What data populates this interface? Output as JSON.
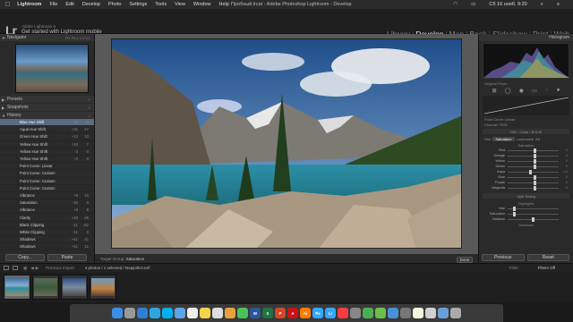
{
  "menubar": {
    "apple": "",
    "app": "Lightroom",
    "items": [
      "File",
      "Edit",
      "Develop",
      "Photo",
      "Settings",
      "Tools",
      "View",
      "Window",
      "Help"
    ],
    "window_title": "Пробный.lrcat - Adobe Photoshop Lightroom - Develop",
    "clock": "Сб 16 нояб. 9:20"
  },
  "identity": {
    "logo": "Lr",
    "product": "Adobe Lightroom 6",
    "tagline": "Get started with Lightroom mobile"
  },
  "modules": [
    {
      "label": "Library",
      "active": false
    },
    {
      "label": "Develop",
      "active": true
    },
    {
      "label": "Map",
      "active": false
    },
    {
      "label": "Book",
      "active": false
    },
    {
      "label": "Slideshow",
      "active": false
    },
    {
      "label": "Print",
      "active": false
    },
    {
      "label": "Web",
      "active": false
    }
  ],
  "left": {
    "navigator": {
      "title": "Navigator",
      "zoom": "FIT FILL 1:1 3:1"
    },
    "presets": "Presets",
    "snapshots": "Snapshots",
    "history_title": "History",
    "history": [
      {
        "label": "Blue Hue Shift",
        "b": "-33",
        "c": "0",
        "selected": true
      },
      {
        "label": "Aqua Hue Shift",
        "b": "+31",
        "c": "47",
        "selected": false
      },
      {
        "label": "Green Hue Shift",
        "b": "+13",
        "c": "13",
        "selected": false
      },
      {
        "label": "Yellow Hue Shift",
        "b": "+10",
        "c": "7",
        "selected": false
      },
      {
        "label": "Yellow Hue Shift",
        "b": "-3",
        "c": "-3",
        "selected": false
      },
      {
        "label": "Yellow Hue Shift",
        "b": "+2",
        "c": "0",
        "selected": false
      },
      {
        "label": "Point Curve: Linear",
        "b": "",
        "c": "",
        "selected": false
      },
      {
        "label": "Point Curve: Custom",
        "b": "",
        "c": "",
        "selected": false
      },
      {
        "label": "Point Curve: Custom",
        "b": "",
        "c": "",
        "selected": false
      },
      {
        "label": "Point Curve: Custom",
        "b": "",
        "c": "",
        "selected": false
      },
      {
        "label": "Vibrance",
        "b": "+8",
        "c": "16",
        "selected": false
      },
      {
        "label": "Saturation",
        "b": "-16",
        "c": "0",
        "selected": false
      },
      {
        "label": "Vibrance",
        "b": "+8",
        "c": "8",
        "selected": false
      },
      {
        "label": "Clarity",
        "b": "+19",
        "c": "26",
        "selected": false
      },
      {
        "label": "Black Clipping",
        "b": "-11",
        "c": "-52",
        "selected": false
      },
      {
        "label": "White Clipping",
        "b": "-11",
        "c": "0",
        "selected": false
      },
      {
        "label": "Shadows",
        "b": "+41",
        "c": "41",
        "selected": false
      },
      {
        "label": "Shadows",
        "b": "+11",
        "c": "11",
        "selected": false
      }
    ],
    "copy_label": "Copy...",
    "paste_label": "Paste"
  },
  "toolbar": {
    "target_label": "Target Group:",
    "target_value": "Saturation",
    "done_label": "Done"
  },
  "right": {
    "histogram_title": "Histogram",
    "original_photo": "Original Photo",
    "point_curve": "Point Curve: Linear",
    "channel": "Channel: RGB",
    "hsl_tabs": [
      "HSL",
      "Color",
      "B & W"
    ],
    "sub_tabs": [
      "Hue",
      "Saturation",
      "Luminance",
      "All"
    ],
    "sliders_title": "Saturation",
    "sliders": [
      {
        "label": "Red",
        "value": "0",
        "pos": 0.5
      },
      {
        "label": "Orange",
        "value": "0",
        "pos": 0.5
      },
      {
        "label": "Yellow",
        "value": "0",
        "pos": 0.5
      },
      {
        "label": "Green",
        "value": "0",
        "pos": 0.5
      },
      {
        "label": "Aqua",
        "value": "-14",
        "pos": 0.42
      },
      {
        "label": "Blue",
        "value": "0",
        "pos": 0.5
      },
      {
        "label": "Purple",
        "value": "0",
        "pos": 0.5
      },
      {
        "label": "Magenta",
        "value": "0",
        "pos": 0.5
      }
    ],
    "split_title": "Split Toning",
    "highlights": "Highlights",
    "hue": "Hue",
    "saturation": "Saturation",
    "balance": "Balance",
    "shadows": "Shadows",
    "previous_label": "Previous",
    "reset_label": "Reset"
  },
  "filmstrip": {
    "previous_import": "Previous Import",
    "info": "4 photos / 1 selected / Nepipi0UI.nef",
    "filter_label": "Filter:",
    "filter_value": "Filters Off"
  },
  "dock": [
    {
      "name": "finder",
      "color": "#3a8ee6"
    },
    {
      "name": "launchpad",
      "color": "#999"
    },
    {
      "name": "safari",
      "color": "#2f7fd6"
    },
    {
      "name": "telegram",
      "color": "#2ca5e0"
    },
    {
      "name": "skype",
      "color": "#00aff0"
    },
    {
      "name": "mail",
      "color": "#5da5e8"
    },
    {
      "name": "calendar",
      "color": "#eee"
    },
    {
      "name": "notes",
      "color": "#f3d44a"
    },
    {
      "name": "reminders",
      "color": "#ddd"
    },
    {
      "name": "photos",
      "color": "#e9a23b"
    },
    {
      "name": "facetime",
      "color": "#4ac25a"
    },
    {
      "name": "word",
      "color": "#2b579a"
    },
    {
      "name": "excel",
      "color": "#217346"
    },
    {
      "name": "powerpoint",
      "color": "#d24726"
    },
    {
      "name": "acrobat",
      "color": "#c11"
    },
    {
      "name": "illustrator",
      "color": "#ff7c00"
    },
    {
      "name": "photoshop",
      "color": "#31a8ff"
    },
    {
      "name": "lightroom",
      "color": "#31a8ff"
    },
    {
      "name": "music",
      "color": "#fc3c44"
    },
    {
      "name": "settings",
      "color": "#888"
    },
    {
      "name": "chrome",
      "color": "#4caf50"
    },
    {
      "name": "maps",
      "color": "#6bc04b"
    },
    {
      "name": "finder2",
      "color": "#4a90d9"
    },
    {
      "name": "files",
      "color": "#777"
    },
    {
      "name": "notes2",
      "color": "#f5f5dc"
    },
    {
      "name": "preview",
      "color": "#cfcfcf"
    },
    {
      "name": "downloads",
      "color": "#6aa0d8"
    },
    {
      "name": "trash",
      "color": "#aaa"
    }
  ],
  "dock_labels": {
    "word": "W",
    "excel": "X",
    "powerpoint": "P",
    "illustrator": "Ai",
    "photoshop": "Ps",
    "lightroom": "Lr",
    "acrobat": "A"
  }
}
